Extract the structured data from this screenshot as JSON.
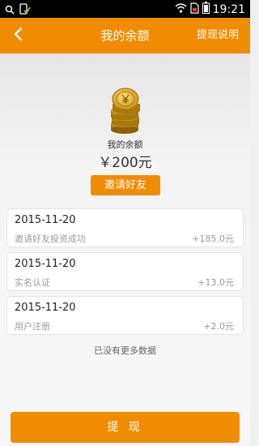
{
  "status_bar": {
    "time": "19:21"
  },
  "header": {
    "title": "我的余额",
    "action_label": "提现说明"
  },
  "balance": {
    "label": "我的余额",
    "amount": "￥200元"
  },
  "invite_button_label": "邀请好友",
  "records": [
    {
      "date": "2015-11-20",
      "description": "邀请好友投资成功",
      "amount": "+185.0元"
    },
    {
      "date": "2015-11-20",
      "description": "实名认证",
      "amount": "+13.0元"
    },
    {
      "date": "2015-11-20",
      "description": "用户注册",
      "amount": "+2.0元"
    }
  ],
  "no_more_text": "已没有更多数据",
  "withdraw_button_label": "提 现",
  "colors": {
    "accent": "#f18b00",
    "status_bar": "#000000"
  }
}
